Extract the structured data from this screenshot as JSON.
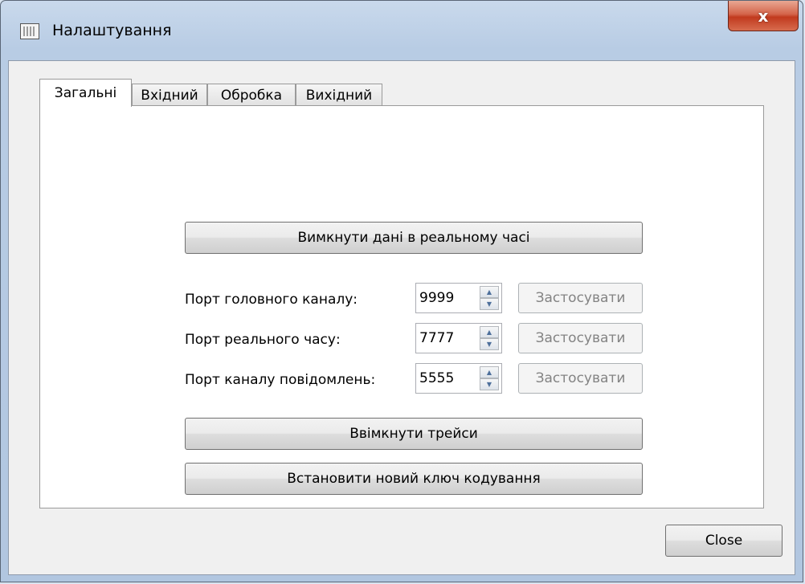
{
  "window": {
    "title": "Налаштування",
    "close_glyph": "x"
  },
  "tabs": [
    {
      "label": "Загальні",
      "active": true
    },
    {
      "label": "Вхідний",
      "active": false
    },
    {
      "label": "Обробка",
      "active": false
    },
    {
      "label": "Вихідний",
      "active": false
    }
  ],
  "general": {
    "realtime_button": "Вимкнути дані в реальному часі",
    "ports": [
      {
        "label": "Порт головного каналу:",
        "value": "9999",
        "apply": "Застосувати"
      },
      {
        "label": "Порт реального часу:",
        "value": "7777",
        "apply": "Застосувати"
      },
      {
        "label": "Порт каналу повідомлень:",
        "value": "5555",
        "apply": "Застосувати"
      }
    ],
    "traces_button": "Ввімкнути трейси",
    "key_button": "Встановити новий ключ кодування"
  },
  "footer": {
    "close_label": "Close"
  },
  "icons": {
    "app": "settings-app-icon",
    "close": "close-icon",
    "spin_up": "arrow-up-icon",
    "spin_down": "arrow-down-icon"
  },
  "colors": {
    "titlebar": "#b9cde5",
    "close_button": "#c7432a",
    "panel_bg": "#ffffff",
    "dialog_bg": "#f0f0f0"
  }
}
